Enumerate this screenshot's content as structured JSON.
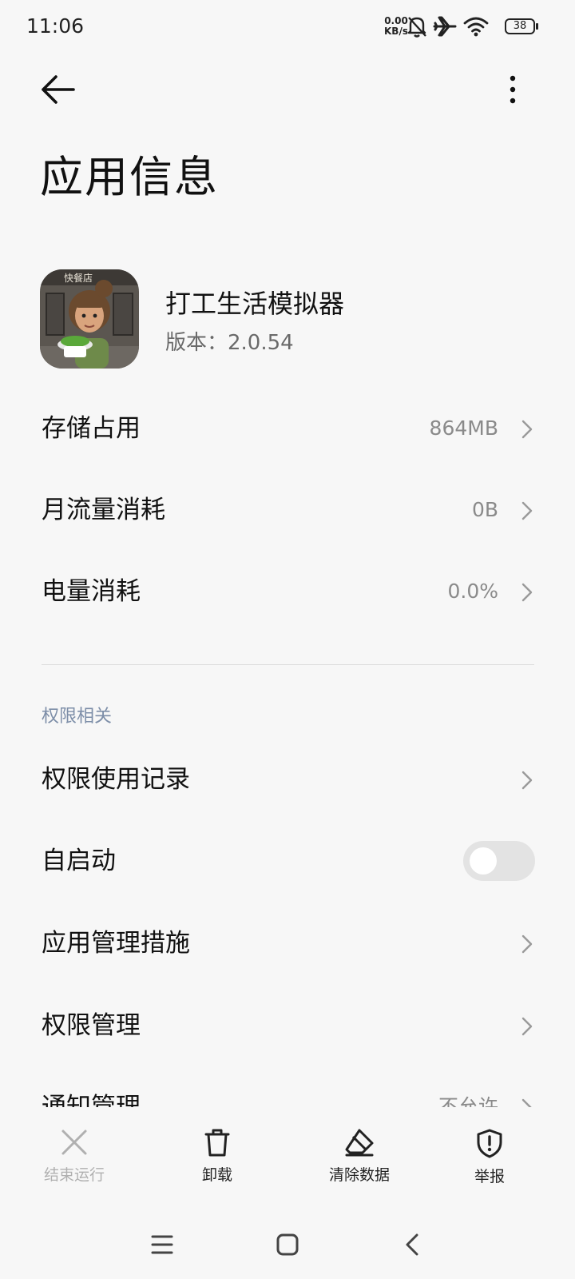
{
  "status_bar": {
    "time": "11:06",
    "net_speed_value": "0.00",
    "net_speed_unit": "KB/s",
    "battery": "38",
    "icons": [
      "mute-bell-icon",
      "airplane-icon",
      "wifi-icon",
      "battery-icon"
    ]
  },
  "header": {
    "title": "应用信息",
    "back_icon": "arrow-left-icon",
    "more_icon": "more-vertical-icon"
  },
  "app": {
    "name": "打工生活模拟器",
    "version": "版本：2.0.54",
    "icon_sign_text": "快餐店"
  },
  "usage": [
    {
      "label": "存储占用",
      "value": "864MB"
    },
    {
      "label": "月流量消耗",
      "value": "0B"
    },
    {
      "label": "电量消耗",
      "value": "0.0%"
    }
  ],
  "permissions_section": {
    "header": "权限相关",
    "items": [
      {
        "label": "权限使用记录",
        "value": ""
      },
      {
        "label": "自启动",
        "toggle": false
      },
      {
        "label": "应用管理措施",
        "value": ""
      },
      {
        "label": "权限管理",
        "value": ""
      },
      {
        "label": "通知管理",
        "value": "不允许"
      }
    ]
  },
  "actions": [
    {
      "label": "结束运行",
      "icon": "close-icon",
      "enabled": false
    },
    {
      "label": "卸载",
      "icon": "trash-icon",
      "enabled": true
    },
    {
      "label": "清除数据",
      "icon": "eraser-icon",
      "enabled": true
    },
    {
      "label": "举报",
      "icon": "shield-alert-icon",
      "enabled": true
    }
  ],
  "nav_bar": {
    "buttons": [
      "menu-icon",
      "home-icon",
      "back-icon"
    ]
  },
  "colors": {
    "background": "#f7f7f7",
    "section_header": "#7d8ea8",
    "secondary_text": "#8a8a8a",
    "disabled": "#b0b0b0"
  }
}
